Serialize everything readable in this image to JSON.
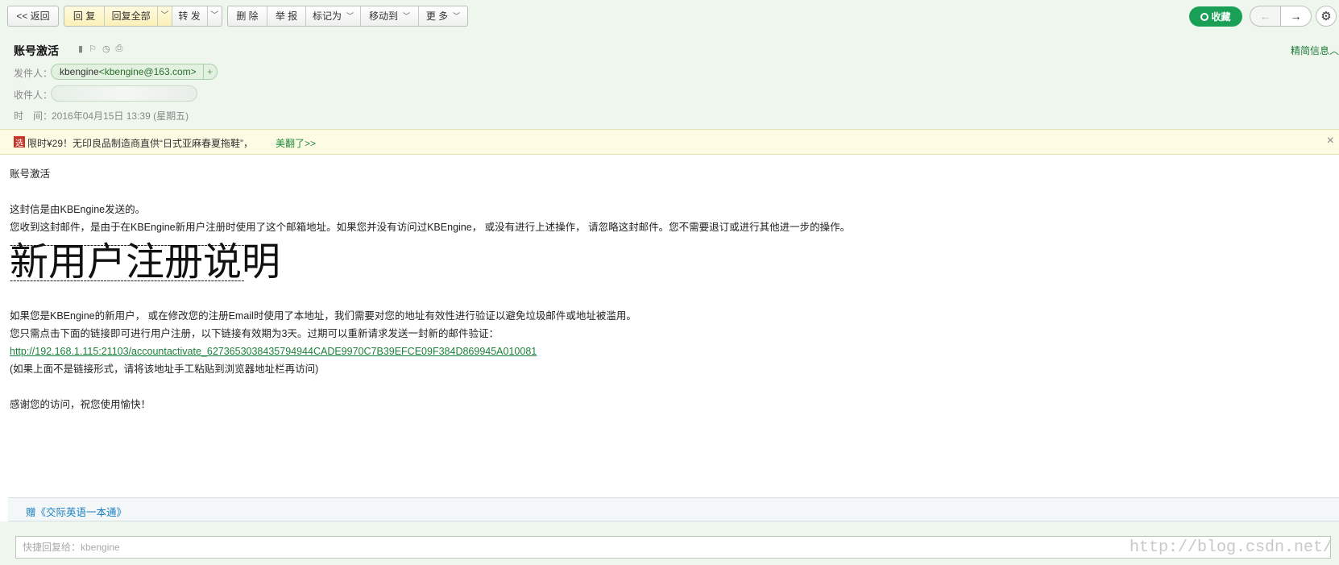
{
  "toolbar": {
    "back": "<< 返回",
    "reply": "回 复",
    "reply_all": "回复全部",
    "forward": "转 发",
    "delete": "删 除",
    "report": "举 报",
    "mark_as": "标记为",
    "move_to": "移动到",
    "more": "更 多",
    "collect": "收藏"
  },
  "header": {
    "subject": "账号激活",
    "detail_toggle": "精简信息",
    "sender_label": "发件人：",
    "sender_name": "kbengine",
    "sender_email": "<kbengine@163.com>",
    "add_contact": "+",
    "recipient_label": "收件人：",
    "time_label": "时　间：",
    "time_value": "2016年04月15日 13:39 (星期五)"
  },
  "ad": {
    "icon_text": "选",
    "text": "限时¥29！无印良品制造商直供“日式亚麻春夏拖鞋”，",
    "link": "美翻了>>",
    "close": "×"
  },
  "email_body": {
    "line_title": "账号激活",
    "line_sent_by": "这封信是由KBEngine发送的。",
    "line_reason": "您收到这封邮件，是由于在KBEngine新用户注册时使用了这个邮箱地址。如果您并没有访问过KBEngine， 或没有进行上述操作， 请忽略这封邮件。您不需要退订或进行其他进一步的操作。",
    "divider": "----------------------------------------------------------------------",
    "heading": "新用户注册说明",
    "line_verify": "如果您是KBEngine的新用户， 或在修改您的注册Email时使用了本地址，我们需要对您的地址有效性进行验证以避免垃圾邮件或地址被滥用。",
    "line_click": "您只需点击下面的链接即可进行用户注册，以下链接有效期为3天。过期可以重新请求发送一封新的邮件验证：",
    "activation_link": "http://192.168.1.115:21103/accountactivate_6273653038435794944CADE9970C7B39EFCE09F384D869945A010081",
    "line_copy": "(如果上面不是链接形式，请将该地址手工粘贴到浏览器地址栏再访问)",
    "line_thanks": "感谢您的访问，祝您使用愉快！"
  },
  "gift": {
    "text": "赠《交际英语一本通》"
  },
  "quick_reply": {
    "placeholder": "快捷回复给：kbengine"
  },
  "watermark": "http://blog.csdn.net/"
}
